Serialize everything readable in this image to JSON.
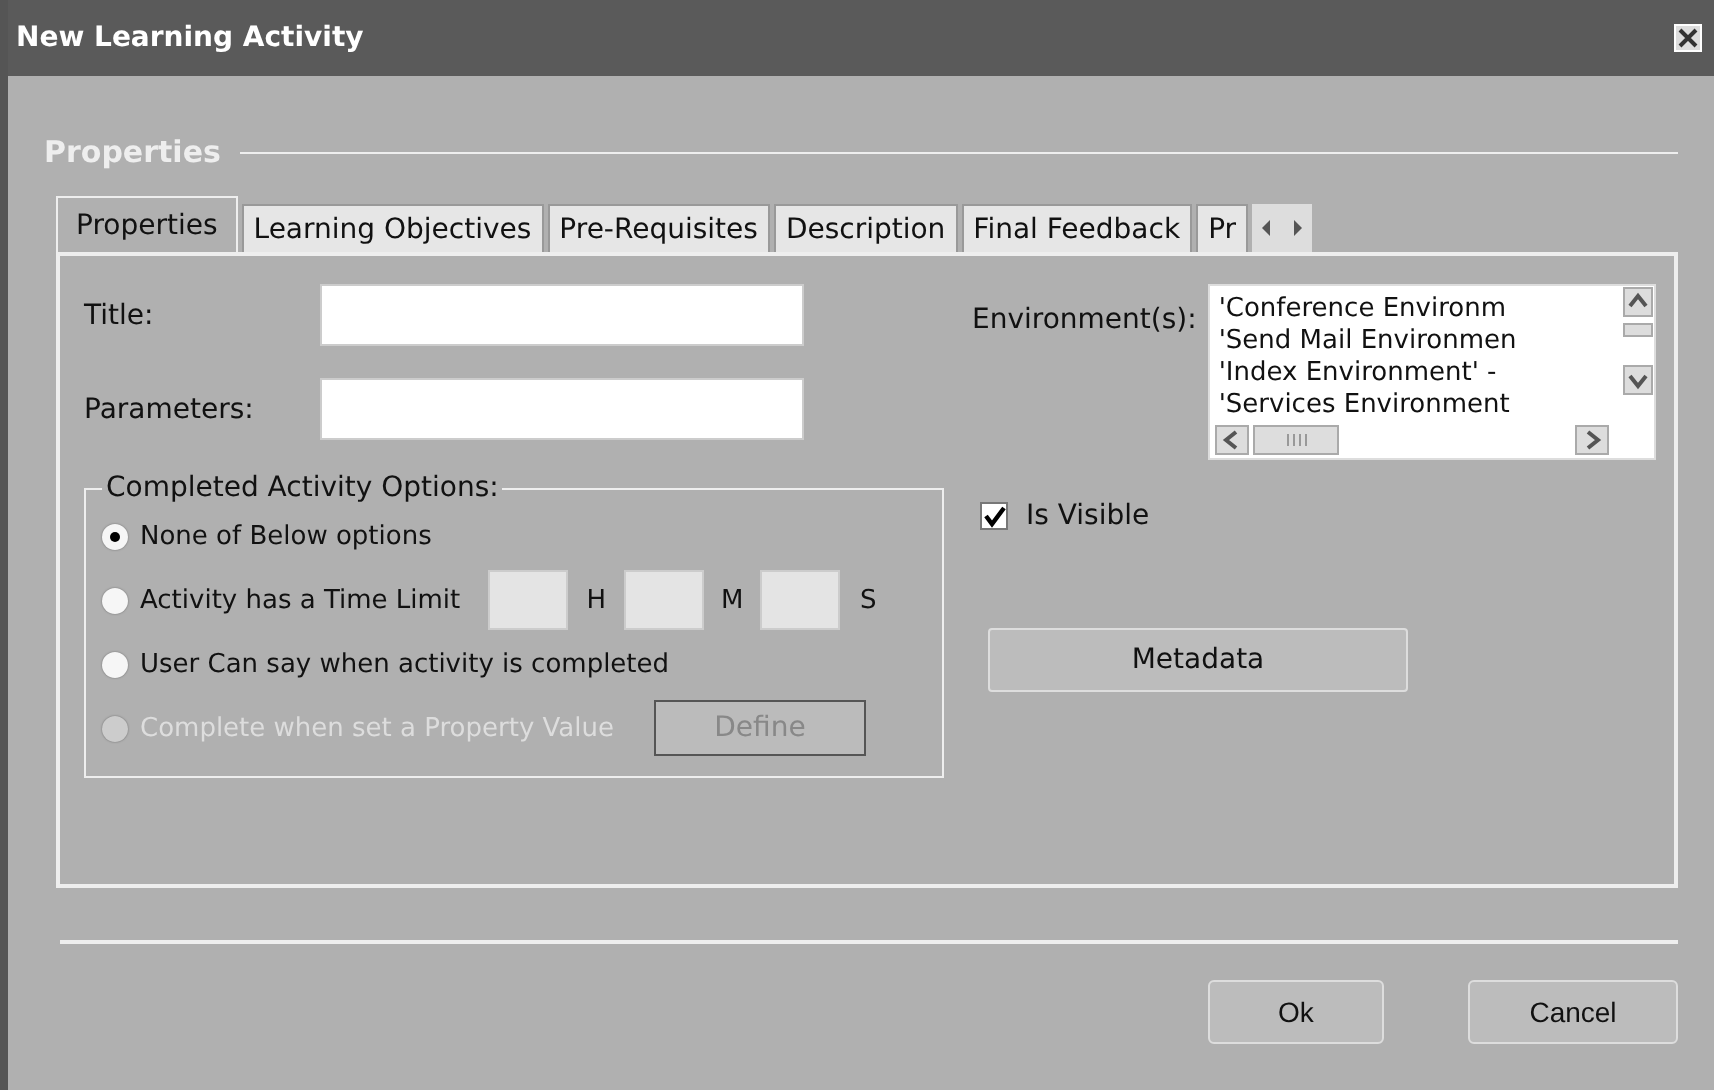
{
  "window": {
    "title": "New Learning Activity"
  },
  "section_title": "Properties",
  "tabs": [
    {
      "label": "Properties",
      "selected": true
    },
    {
      "label": "Learning Objectives",
      "selected": false
    },
    {
      "label": "Pre-Requisites",
      "selected": false
    },
    {
      "label": "Description",
      "selected": false
    },
    {
      "label": "Final Feedback",
      "selected": false
    },
    {
      "label": "Pr",
      "selected": false
    }
  ],
  "fields": [
    {
      "label": "Title:"
    },
    {
      "label": "Parameters:"
    }
  ],
  "environments": {
    "label": "Environment(s):",
    "items": [
      "'Conference Environm",
      "'Send Mail Environmen",
      "'Index Environment' -",
      "'Services Environment"
    ]
  },
  "completed_options": {
    "legend": "Completed Activity Options:",
    "options": [
      {
        "kind": "plain",
        "label": "None of Below options",
        "selected": true,
        "disabled": false
      },
      {
        "kind": "time",
        "label": "Activity has a Time Limit",
        "selected": false,
        "disabled": false,
        "units": [
          "H",
          "M",
          "S"
        ]
      },
      {
        "kind": "plain",
        "label": "User Can say when activity is completed",
        "selected": false,
        "disabled": false
      },
      {
        "kind": "define",
        "label": "Complete when set a Property Value",
        "selected": false,
        "disabled": true,
        "button": "Define"
      }
    ]
  },
  "is_visible": {
    "label": "Is Visible",
    "checked": true
  },
  "metadata_button": "Metadata",
  "buttons": [
    "Ok",
    "Cancel"
  ]
}
